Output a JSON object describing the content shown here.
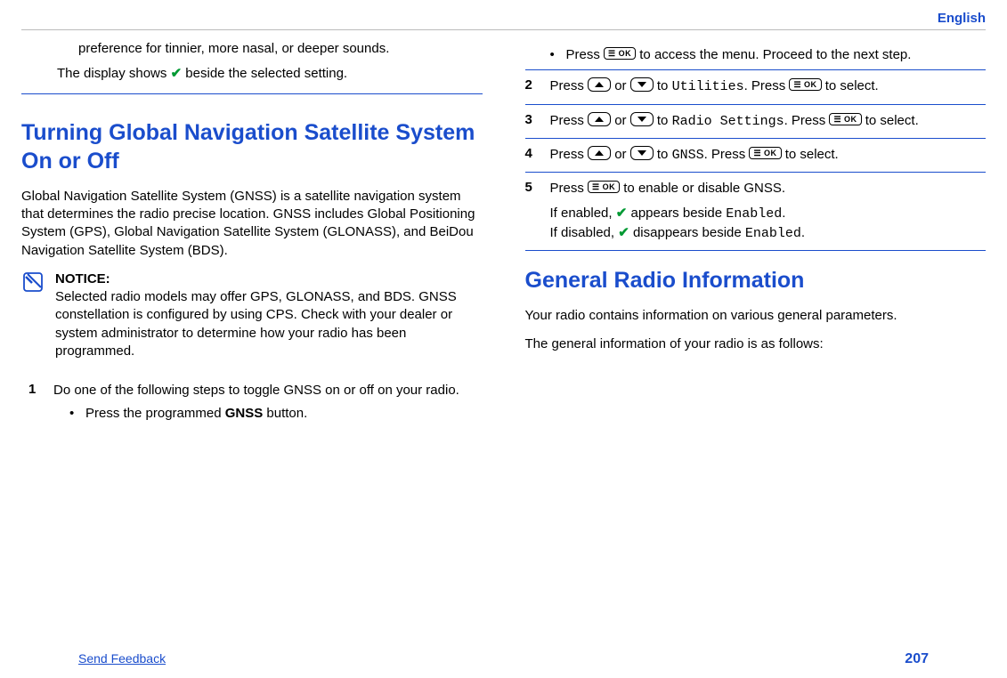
{
  "header": {
    "lang": "English"
  },
  "left": {
    "pref_line": "preference for tinnier, more nasal, or deeper sounds.",
    "display_shows_pre": "The display shows ",
    "display_shows_post": " beside the selected setting.",
    "heading": "Turning Global Navigation Satellite System On or Off",
    "intro": "Global Navigation Satellite System (GNSS) is a satellite navigation system that determines the radio precise location. GNSS includes Global Positioning System (GPS), Global Navigation Satellite System (GLONASS), and BeiDou Navigation Satellite System (BDS).",
    "notice_title": "NOTICE:",
    "notice_body": "Selected radio models may offer GPS, GLONASS, and BDS. GNSS constellation is configured by using CPS. Check with your dealer or system administrator to determine how your radio has been programmed.",
    "step1_num": "1",
    "step1_body": "Do one of the following steps to toggle GNSS on or off on your radio.",
    "step1_bullet_pre": "Press the programmed ",
    "step1_bullet_bold": "GNSS",
    "step1_bullet_post": " button."
  },
  "right": {
    "top_bullet_pre": "Press ",
    "top_bullet_post": " to access the menu. Proceed to the next step.",
    "step2_num": "2",
    "step2_pre": "Press ",
    "step2_or": " or ",
    "step2_to": " to ",
    "step2_code": "Utilities",
    "step2_mid": ". Press ",
    "step2_post": " to select.",
    "step3_num": "3",
    "step3_pre": "Press ",
    "step3_or": " or ",
    "step3_to": " to ",
    "step3_code": "Radio Settings",
    "step3_mid": ". Press ",
    "step3_post": " to select.",
    "step4_num": "4",
    "step4_pre": "Press ",
    "step4_or": " or ",
    "step4_to": " to ",
    "step4_code": "GNSS",
    "step4_mid": ". Press ",
    "step4_post": " to select.",
    "step5_num": "5",
    "step5_pre": "Press ",
    "step5_post": " to enable or disable GNSS.",
    "step5_result1a": "If enabled, ",
    "step5_result1b": " appears beside ",
    "step5_result1c": "Enabled",
    "step5_result1d": ".",
    "step5_result2a": "If disabled, ",
    "step5_result2b": " disappears beside ",
    "step5_result2c": "Enabled",
    "step5_result2d": ".",
    "heading2": "General Radio Information",
    "gri_p1": "Your radio contains information on various general parameters.",
    "gri_p2": "The general information of your radio is as follows:"
  },
  "footer": {
    "send_feedback": "Send Feedback",
    "page": "207"
  }
}
